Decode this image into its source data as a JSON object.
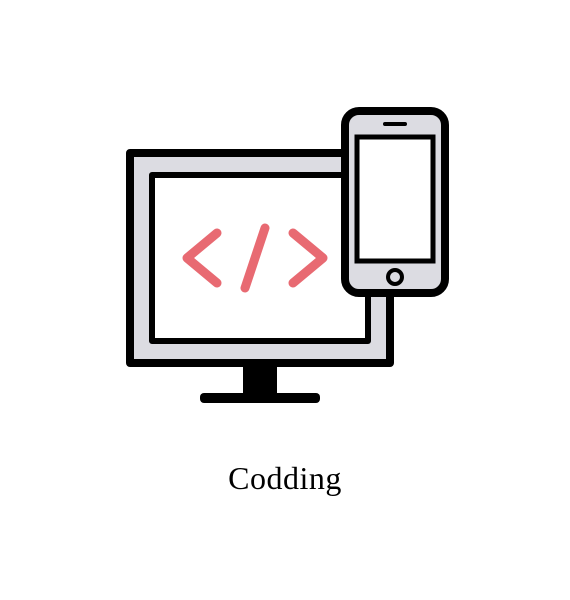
{
  "caption": "Codding",
  "colors": {
    "outline": "#000000",
    "bezel": "#dcdce2",
    "screen": "#ffffff",
    "accent": "#e86a72"
  }
}
